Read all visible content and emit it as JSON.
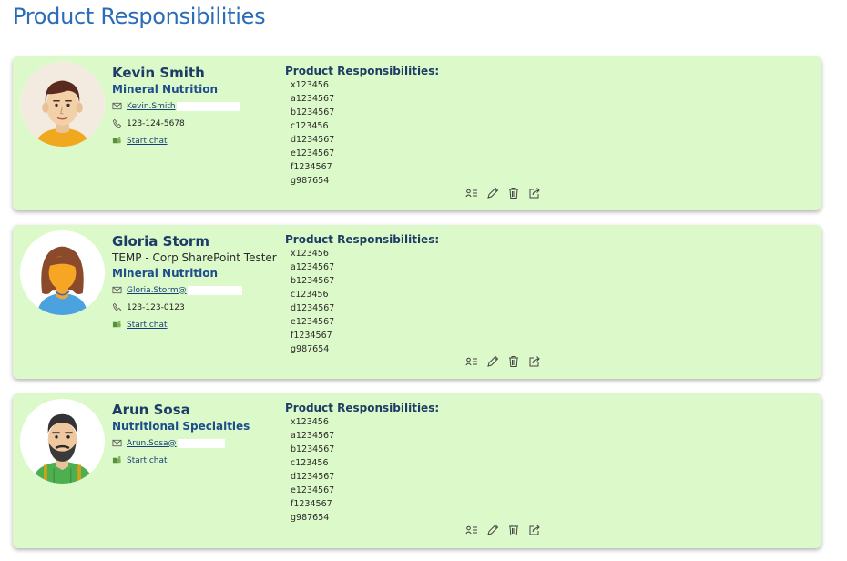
{
  "page": {
    "title": "Product Responsibilities"
  },
  "people": [
    {
      "name": "Kevin Smith",
      "department": "Mineral Nutrition",
      "email": "Kevin.Smith",
      "phone": "123-124-5678",
      "chat_label": "Start chat",
      "resp_title": "Product Responsibilities:",
      "responsibilities": [
        "x123456",
        "a1234567",
        "b1234567",
        "c123456",
        "d1234567",
        "e1234567",
        "f1234567",
        "g987654"
      ],
      "avatar": "man-brown-hair"
    },
    {
      "name": "Gloria Storm",
      "job_title": "TEMP - Corp SharePoint Tester",
      "department": "Mineral Nutrition",
      "email": "Gloria.Storm@",
      "phone": "123-123-0123",
      "chat_label": "Start chat",
      "resp_title": "Product Responsibilities:",
      "responsibilities": [
        "x123456",
        "a1234567",
        "b1234567",
        "c123456",
        "d1234567",
        "e1234567",
        "f1234567",
        "g987654"
      ],
      "avatar": "woman-brown-hair"
    },
    {
      "name": "Arun Sosa",
      "department": "Nutritional Specialties",
      "email": "Arun.Sosa@",
      "chat_label": "Start chat",
      "resp_title": "Product Responsibilities:",
      "responsibilities": [
        "x123456",
        "a1234567",
        "b1234567",
        "c123456",
        "d1234567",
        "e1234567",
        "f1234567",
        "g987654"
      ],
      "avatar": "man-beard"
    }
  ],
  "icons": {
    "email": "mail-icon",
    "phone": "phone-icon",
    "chat": "teams-icon",
    "actions": [
      "details-icon",
      "edit-icon",
      "delete-icon",
      "share-icon"
    ]
  },
  "colors": {
    "card_bg": "#dcf9c9",
    "title": "#2b6cb8",
    "name": "#1d3c66",
    "dept": "#1d4d8c"
  }
}
